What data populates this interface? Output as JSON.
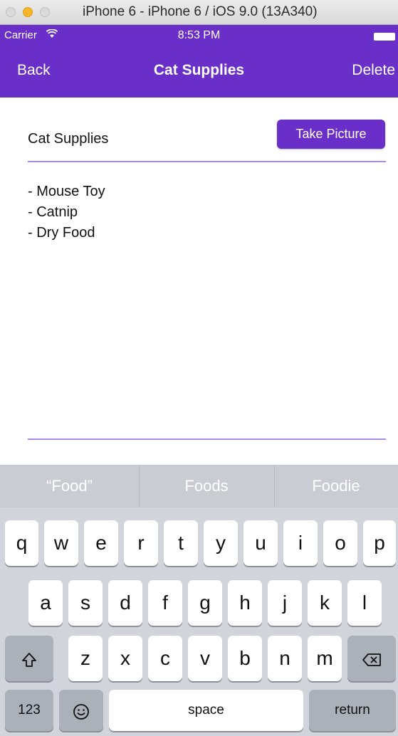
{
  "simulator": {
    "title": "iPhone 6 - iPhone 6 / iOS 9.0 (13A340)"
  },
  "status_bar": {
    "carrier": "Carrier",
    "wifi_icon": "wifi-icon",
    "time": "8:53 PM",
    "battery_icon": "battery-icon"
  },
  "nav": {
    "back_label": "Back",
    "title": "Cat Supplies",
    "delete_label": "Delete"
  },
  "form": {
    "title_value": "Cat Supplies",
    "take_picture_label": "Take Picture",
    "notes_lines": [
      "- Mouse Toy",
      "- Catnip",
      "- Dry Food"
    ]
  },
  "keyboard": {
    "suggestions": [
      "“Food”",
      "Foods",
      "Foodie"
    ],
    "row1": [
      "q",
      "w",
      "e",
      "r",
      "t",
      "y",
      "u",
      "i",
      "o",
      "p"
    ],
    "row2": [
      "a",
      "s",
      "d",
      "f",
      "g",
      "h",
      "j",
      "k",
      "l"
    ],
    "row3": [
      "z",
      "x",
      "c",
      "v",
      "b",
      "n",
      "m"
    ],
    "shift_icon": "shift-icon",
    "backspace_icon": "backspace-icon",
    "numbers_label": "123",
    "emoji_icon": "emoji-icon",
    "space_label": "space",
    "return_label": "return"
  },
  "colors": {
    "accent": "#6a2fc8",
    "divider": "#a98bea",
    "keyboard_bg": "#d1d5db"
  }
}
